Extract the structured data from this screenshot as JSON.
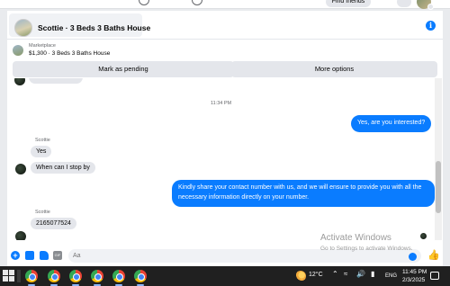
{
  "topbar": {
    "find_friends_label": "Find friends"
  },
  "chat": {
    "title": "Scottie · 3 Beds 3 Baths House",
    "listing": {
      "source": "Marketplace",
      "price_title": "$1,300 · 3 Beds 3 Baths House",
      "mark_pending_label": "Mark as pending",
      "more_options_label": "More options"
    },
    "timestamp": "11:34 PM",
    "messages": [
      {
        "direction": "out",
        "text": "Yes, are you interested?"
      },
      {
        "direction": "in",
        "sender": "Scottie",
        "text": "Yes"
      },
      {
        "direction": "in",
        "text": "When can I stop by"
      },
      {
        "direction": "out",
        "text": "Kindly share your contact number with us, and we will ensure to provide you with all the necessary information directly on your number."
      },
      {
        "direction": "in",
        "sender": "Scottie",
        "text": "2165077524"
      }
    ],
    "composer": {
      "placeholder": "Aa"
    }
  },
  "watermark": {
    "title": "Activate Windows",
    "subtitle": "Go to Settings to activate Windows."
  },
  "taskbar": {
    "weather_temp": "12°C",
    "language": "ENG",
    "time": "11:45 PM",
    "date": "2/3/2025"
  },
  "colors": {
    "accent": "#0a7cff",
    "incoming_bubble": "#e4e6eb",
    "taskbar": "#202020"
  }
}
